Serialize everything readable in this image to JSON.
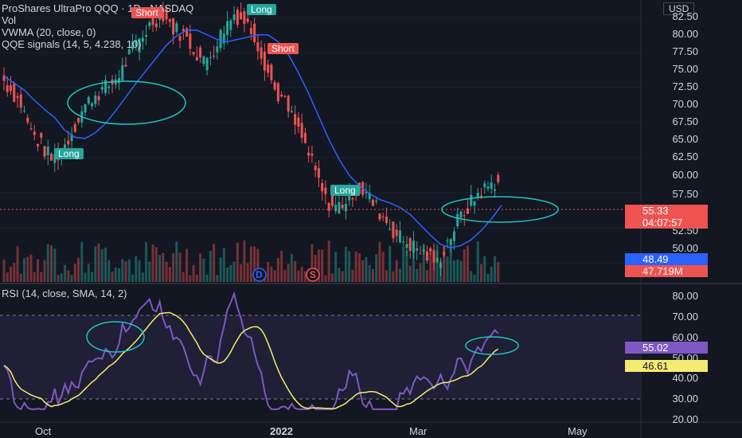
{
  "legend": {
    "symbol_line": "ProShares UltraPro QQQ · 1D · NASDAQ",
    "vol": "Vol",
    "vwma": "VWMA (20, close, 0)",
    "qqe": "QQE signals (14, 5, 4.238, 10)",
    "rsi": "RSI (14, close, SMA, 14, 2)"
  },
  "currency": "USD",
  "price_scale": [
    "82.50",
    "80.00",
    "77.50",
    "75.00",
    "72.50",
    "70.00",
    "67.50",
    "65.00",
    "62.50",
    "60.00",
    "57.50",
    "52.50",
    "50.00"
  ],
  "rsi_scale": [
    "80.00",
    "70.00",
    "60.00",
    "50.00",
    "40.00",
    "30.00",
    "20.00"
  ],
  "badges": {
    "last_price": "55.33",
    "countdown": "04:07:57",
    "vwma_value": "48.49",
    "volume_value": "47.719M",
    "rsi_value": "55.02",
    "rsi_sma_value": "46.61"
  },
  "signals": [
    {
      "label": "Short"
    },
    {
      "label": "Long"
    },
    {
      "label": "Short"
    },
    {
      "label": "Long"
    },
    {
      "label": "Long"
    }
  ],
  "markers": {
    "dividend": "D",
    "split": "S"
  },
  "time_axis": [
    "Oct",
    "2022",
    "Mar",
    "May"
  ],
  "colors": {
    "background": "#131722",
    "up": "#26a69a",
    "down": "#ef5350",
    "vwma": "#2962ff",
    "rsi": "#7e57c2",
    "rsi_sma": "#f5eb71",
    "annotation": "#22c5c1"
  },
  "chart_data": [
    {
      "type": "candlestick",
      "title": "ProShares UltraPro QQQ",
      "x_range": [
        "2021-09",
        "2022-05"
      ],
      "ylim": [
        47.5,
        83.5
      ],
      "approx_close": [
        74,
        72,
        70,
        66,
        64,
        62,
        63,
        66,
        69,
        71,
        72,
        73,
        75,
        78,
        80,
        82,
        83,
        81,
        80,
        78,
        76,
        78,
        81,
        83,
        82,
        80,
        76,
        72,
        70,
        67,
        64,
        60,
        56,
        55,
        56,
        58,
        57,
        55,
        53,
        51,
        50,
        49,
        48,
        47,
        50,
        53,
        55,
        57,
        58,
        59
      ],
      "series": [
        {
          "name": "VWMA (20, close, 0)",
          "last": 48.49
        }
      ]
    },
    {
      "type": "line",
      "title": "RSI (14, close, SMA, 14, 2)",
      "ylim": [
        20,
        80
      ],
      "series": [
        {
          "name": "RSI",
          "last": 55.02
        },
        {
          "name": "SMA",
          "last": 46.61
        }
      ]
    }
  ]
}
